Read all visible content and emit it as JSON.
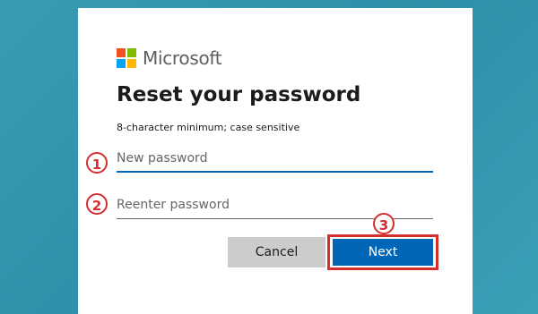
{
  "brand": {
    "name": "Microsoft",
    "logo_colors": [
      "#f25022",
      "#7fba00",
      "#00a4ef",
      "#ffb900"
    ]
  },
  "title": "Reset your password",
  "hint": "8-character minimum; case sensitive",
  "fields": {
    "new_password": {
      "placeholder": "New password",
      "marker": "1"
    },
    "reenter_password": {
      "placeholder": "Reenter password",
      "marker": "2"
    }
  },
  "buttons": {
    "cancel": "Cancel",
    "next": "Next",
    "next_marker": "3"
  },
  "colors": {
    "accent": "#0067b8",
    "annotation": "#d32f2f",
    "background": "#3a9bb2"
  }
}
